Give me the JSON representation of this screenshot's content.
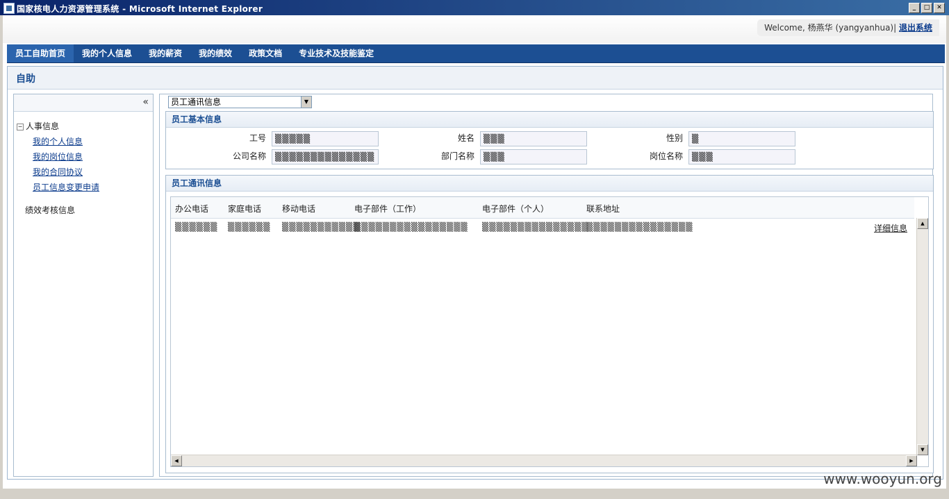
{
  "window": {
    "title": "国家核电人力资源管理系统 - Microsoft Internet Explorer"
  },
  "header": {
    "welcome": "Welcome, 杨燕华 (yangyanhua)|",
    "logout": "退出系统"
  },
  "nav": {
    "items": [
      "员工自助首页",
      "我的个人信息",
      "我的薪资",
      "我的绩效",
      "政策文档",
      "专业技术及技能鉴定"
    ]
  },
  "page": {
    "title": "自助"
  },
  "sidebar": {
    "collapse": "«",
    "group1": "人事信息",
    "items": [
      "我的个人信息",
      "我的岗位信息",
      "我的合同协议",
      "员工信息变更申请"
    ],
    "group2": "绩效考核信息"
  },
  "main": {
    "select": "员工通讯信息",
    "basic": {
      "title": "员工基本信息",
      "labels": {
        "id": "工号",
        "name": "姓名",
        "gender": "性别",
        "company": "公司名称",
        "dept": "部门名称",
        "position": "岗位名称"
      },
      "values": {
        "id": "▒▒▒▒▒",
        "name": "▒▒▒",
        "gender": "▒",
        "company": "▒▒▒▒▒▒▒▒▒▒▒▒▒▒",
        "dept": "▒▒▒",
        "position": "▒▒▒"
      }
    },
    "contact": {
      "title": "员工通讯信息",
      "columns": [
        "办公电话",
        "家庭电话",
        "移动电话",
        "电子部件（工作）",
        "电子部件（个人）",
        "联系地址"
      ],
      "row": [
        "▒▒▒▒▒▒",
        "▒▒▒▒▒▒",
        "▒▒▒▒▒▒▒▒▒▒▒",
        "▒▒▒▒▒▒▒▒▒▒▒▒▒▒▒▒",
        "▒▒▒▒▒▒▒▒▒▒▒▒▒▒▒",
        "▒▒▒▒▒▒▒▒▒▒▒▒▒▒▒"
      ],
      "detail": "详细信息"
    }
  },
  "watermark": "www.wooyun.org"
}
